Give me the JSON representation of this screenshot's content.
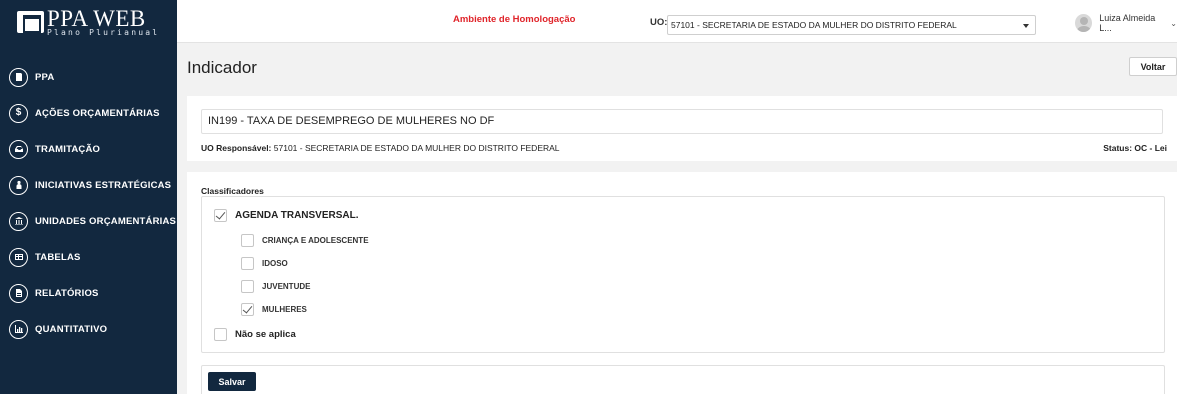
{
  "app": {
    "title": "PPA WEB",
    "subtitle": "Plano Plurianual"
  },
  "sidebar": {
    "items": [
      {
        "label": "PPA",
        "icon": "ppa-icon"
      },
      {
        "label": "AÇÕES ORÇAMENTÁRIAS",
        "icon": "dollar-icon"
      },
      {
        "label": "TRAMITAÇÃO",
        "icon": "inbox-icon"
      },
      {
        "label": "INICIATIVAS ESTRATÉGICAS",
        "icon": "people-icon"
      },
      {
        "label": "UNIDADES ORÇAMENTÁRIAS",
        "icon": "bank-icon"
      },
      {
        "label": "TABELAS",
        "icon": "table-icon"
      },
      {
        "label": "RELATÓRIOS",
        "icon": "document-icon"
      },
      {
        "label": "QUANTITATIVO",
        "icon": "bar-chart-icon"
      }
    ]
  },
  "header": {
    "environment": "Ambiente de Homologação",
    "uo_label": "UO:",
    "uo_value": "57101 - SECRETARIA DE ESTADO DA MULHER DO DISTRITO FEDERAL",
    "user_name": "Luiza Almeida L...",
    "user_caret": "⌄"
  },
  "page": {
    "title": "Indicador",
    "back_label": "Voltar"
  },
  "indicator": {
    "name": "IN199 - TAXA DE DESEMPREGO DE MULHERES NO DF",
    "uo_resp_label": "UO Responsável:",
    "uo_resp_value": "57101 - SECRETARIA DE ESTADO DA MULHER DO DISTRITO FEDERAL",
    "status": "Status: OC - Lei"
  },
  "classificadores": {
    "title": "Classificadores",
    "main": {
      "label": "AGENDA TRANSVERSAL.",
      "checked": true
    },
    "sub": [
      {
        "label": "CRIANÇA E ADOLESCENTE",
        "checked": false
      },
      {
        "label": "IDOSO",
        "checked": false
      },
      {
        "label": "JUVENTUDE",
        "checked": false
      },
      {
        "label": "MULHERES",
        "checked": true
      }
    ],
    "not_applicable": {
      "label": "Não se aplica",
      "checked": false
    }
  },
  "actions": {
    "save_label": "Salvar"
  },
  "colors": {
    "sidebar_bg": "#12283f",
    "environment_text": "#e0242a",
    "save_button_bg": "#12283f"
  }
}
